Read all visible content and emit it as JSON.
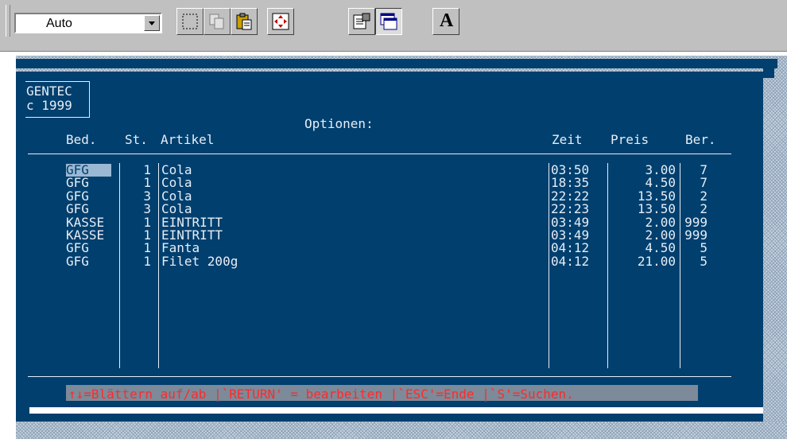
{
  "toolbar": {
    "font_value": "Auto",
    "buttons": [
      {
        "name": "mark-icon"
      },
      {
        "name": "copy-icon"
      },
      {
        "name": "paste-icon"
      },
      {
        "name": "fullscreen-icon"
      },
      {
        "name": "properties-icon"
      },
      {
        "name": "background-icon"
      },
      {
        "name": "font-icon",
        "letter": "A"
      }
    ]
  },
  "console": {
    "brand_line1": "GENTEC",
    "brand_line2": "c 1999",
    "title": "Optionen:",
    "headers": {
      "bed": "Bed.",
      "st": "St.",
      "artikel": "Artikel",
      "zeit": "Zeit",
      "preis": "Preis",
      "ber": "Ber."
    },
    "rows": [
      {
        "bed": "GFG",
        "st": "1",
        "artikel": "Cola",
        "zeit": "03:50",
        "preis": "3.00",
        "ber": "7"
      },
      {
        "bed": "GFG",
        "st": "1",
        "artikel": "Cola",
        "zeit": "18:35",
        "preis": "4.50",
        "ber": "7"
      },
      {
        "bed": "GFG",
        "st": "3",
        "artikel": "Cola",
        "zeit": "22:22",
        "preis": "13.50",
        "ber": "2"
      },
      {
        "bed": "GFG",
        "st": "3",
        "artikel": "Cola",
        "zeit": "22:23",
        "preis": "13.50",
        "ber": "2"
      },
      {
        "bed": "KASSE",
        "st": "1",
        "artikel": "EINTRITT",
        "zeit": "03:49",
        "preis": "2.00",
        "ber": "999"
      },
      {
        "bed": "KASSE",
        "st": "1",
        "artikel": "EINTRITT",
        "zeit": "03:49",
        "preis": "2.00",
        "ber": "999"
      },
      {
        "bed": "GFG",
        "st": "1",
        "artikel": "Fanta",
        "zeit": "04:12",
        "preis": "4.50",
        "ber": "5"
      },
      {
        "bed": "GFG",
        "st": "1",
        "artikel": "Filet 200g",
        "zeit": "04:12",
        "preis": "21.00",
        "ber": "5"
      }
    ],
    "status": "↑↓=Blättern auf/ab |`RETURN' = bearbeiten |`ESC'=Ende |`S'=Suchen."
  }
}
